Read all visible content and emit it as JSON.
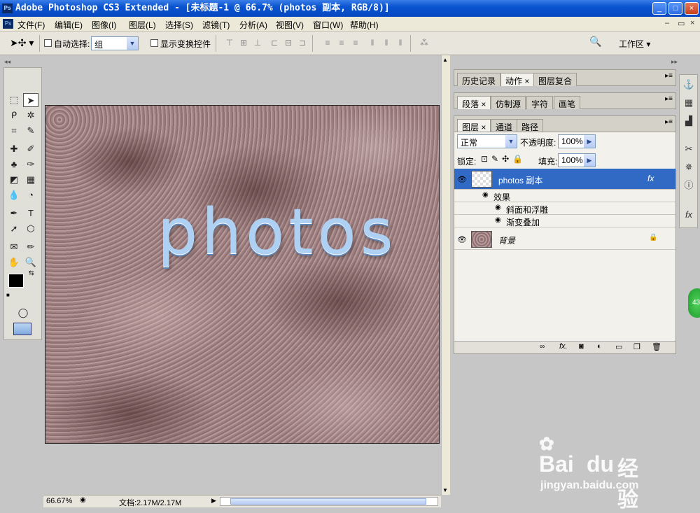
{
  "window": {
    "title": "Adobe Photoshop CS3 Extended - [未标题-1 @ 66.7% (photos 副本, RGB/8)]",
    "logo": "Ps",
    "buttons": [
      "_",
      "□",
      "×"
    ]
  },
  "menubar": {
    "items": [
      "文件(F)",
      "编辑(E)",
      "图像(I)",
      "图层(L)",
      "选择(S)",
      "滤镜(T)",
      "分析(A)",
      "视图(V)",
      "窗口(W)",
      "帮助(H)"
    ],
    "mdi_buttons": [
      "–",
      "▭",
      "×"
    ]
  },
  "options": {
    "auto_select_label": "自动选择:",
    "auto_select_value": "组",
    "show_transform_label": "显示变换控件",
    "workspace_label": "工作区 ▾"
  },
  "canvas": {
    "text": "photos"
  },
  "status": {
    "zoom": "66.67%",
    "doc_info": "文档:2.17M/2.17M"
  },
  "panels": {
    "group1_tabs": [
      "历史记录",
      "动作 ×",
      "图层复合"
    ],
    "group2_tabs": [
      "段落 ×",
      "仿制源",
      "字符",
      "画笔"
    ],
    "group3_tabs": [
      "图层 ×",
      "通道",
      "路径"
    ]
  },
  "layers_panel": {
    "blend_mode": "正常",
    "opacity_label": "不透明度:",
    "opacity_value": "100%",
    "lock_label": "锁定:",
    "fill_label": "填充:",
    "fill_value": "100%",
    "layers": [
      {
        "name": "photos 副本",
        "selected": true,
        "fx": "fx"
      },
      {
        "name": "效果"
      },
      {
        "name": "斜面和浮雕"
      },
      {
        "name": "渐变叠加"
      },
      {
        "name": "背景",
        "locked": true
      }
    ],
    "bottom_icons": [
      "link-icon",
      "fx-icon",
      "mask-icon",
      "adjustment-icon",
      "folder-icon",
      "new-layer-icon",
      "trash-icon"
    ]
  },
  "watermark": {
    "brand": "Bai",
    "brand2": "du",
    "jingyan": "经验",
    "url": "jingyan.baidu.com"
  },
  "side_button": "43"
}
